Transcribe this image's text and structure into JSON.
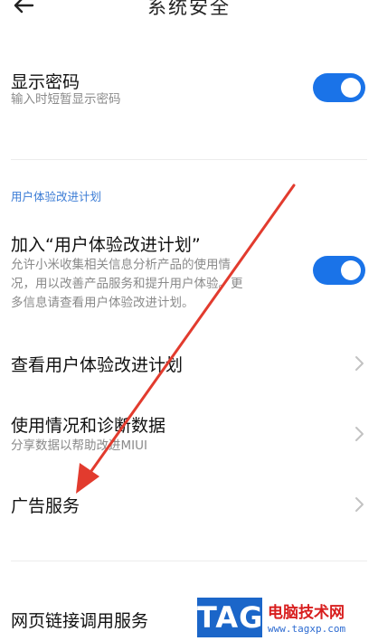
{
  "header": {
    "title": "系统安全",
    "back_icon": "back-arrow-icon"
  },
  "show_password": {
    "title": "显示密码",
    "description": "输入时短暂显示密码",
    "enabled": true
  },
  "section": {
    "label": "用户体验改进计划"
  },
  "join_program": {
    "title": "加入“用户体验改进计划”",
    "description_lines": [
      "允许小米收集相关信息分析产品的使用情",
      "况，用以改善产品服务和提升用户体验。更",
      "多信息请查看用户体验改进计划。"
    ],
    "enabled": true
  },
  "view_program": {
    "title": "查看用户体验改进计划"
  },
  "diagnostics": {
    "title": "使用情况和诊断数据",
    "description": "分享数据以帮助改进MIUI"
  },
  "ad_service": {
    "title": "广告服务"
  },
  "web_link": {
    "title": "网页链接调用服务"
  },
  "watermark": {
    "logo": "TAG",
    "name": "电脑技术网",
    "url": "www.tagxp.com"
  },
  "colors": {
    "accent": "#1a73e8",
    "annotation": "#e23b2e",
    "section": "#3a7bd5"
  }
}
